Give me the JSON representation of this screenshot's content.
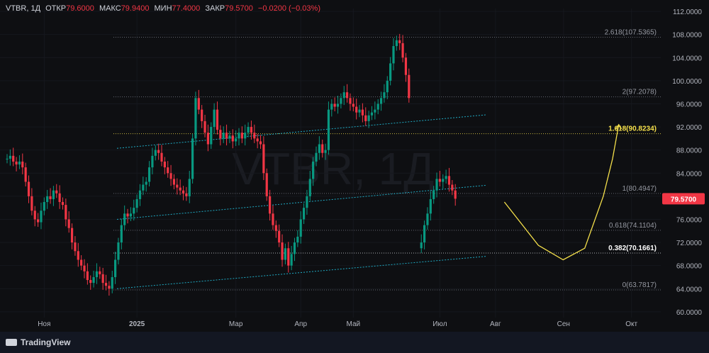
{
  "legend": {
    "symbol": "VTBR, 1Д",
    "open_label": "ОТКР",
    "open": "79.6000",
    "high_label": "МАКС",
    "high": "79.9400",
    "low_label": "МИН",
    "low": "77.4000",
    "close_label": "ЗАКР",
    "close": "79.5700",
    "change": "−0.0200 (−0.03%)"
  },
  "watermark": "VTBR, 1Д",
  "footer": {
    "brand": "TradingView"
  },
  "colors": {
    "up": "#089981",
    "down": "#f23645",
    "fib": "#787b86",
    "fib_highlight": "#f5e04b",
    "channel": "#1fa9c2",
    "projection": "#f5e04b",
    "price_tag": "#f23645"
  },
  "chart_data": {
    "type": "candlestick",
    "ylim": [
      59,
      112.5
    ],
    "y_ticks": [
      "112.0000",
      "108.0000",
      "104.0000",
      "100.0000",
      "96.0000",
      "92.0000",
      "88.0000",
      "84.0000",
      "80.0000",
      "76.0000",
      "72.0000",
      "68.0000",
      "64.0000",
      "60.0000"
    ],
    "x_ticks": [
      "Ноя",
      "2025",
      "Мар",
      "Апр",
      "Май",
      "Июл",
      "Авг",
      "Сен",
      "Окт"
    ],
    "last_price": "79.5700",
    "fib_levels": [
      {
        "label": "2.618(107.5365)",
        "value": 107.5365
      },
      {
        "label": "2(97.2078)",
        "value": 97.2078
      },
      {
        "label": "1.618(90.8234)",
        "value": 90.8234,
        "highlight": true
      },
      {
        "label": "1(80.4947)",
        "value": 80.4947
      },
      {
        "label": "0.618(74.1104)",
        "value": 74.1104
      },
      {
        "label": "0.382(70.1661)",
        "value": 70.1661,
        "highlight": true
      },
      {
        "label": "0(63.7817)",
        "value": 63.7817
      }
    ],
    "channel_lines": [
      {
        "from": [
          0,
          64.0
        ],
        "to": [
          155,
          69.6
        ]
      },
      {
        "from": [
          0,
          76.0
        ],
        "to": [
          155,
          81.9
        ]
      },
      {
        "from": [
          0,
          88.3
        ],
        "to": [
          155,
          94.1
        ]
      }
    ],
    "projection_path": [
      [
        115,
        79.0
      ],
      [
        126,
        71.5
      ],
      [
        134,
        69.0
      ],
      [
        141,
        71.0
      ],
      [
        147,
        80.0
      ],
      [
        150,
        86.5
      ],
      [
        152,
        92.4
      ]
    ],
    "closes": [
      86.5,
      87,
      86,
      85.5,
      86,
      85,
      82.5,
      80,
      77.5,
      76,
      75.5,
      77.5,
      79,
      80,
      79.5,
      81,
      80.5,
      79,
      78.5,
      76,
      74.5,
      72,
      70.5,
      69,
      68,
      67,
      65.5,
      65,
      66,
      67,
      66.5,
      65,
      64.5,
      64,
      66,
      69,
      72,
      75,
      77,
      76.5,
      77,
      78,
      79.5,
      81,
      82,
      82.5,
      85,
      87,
      88,
      87.5,
      86,
      85,
      84,
      83,
      82,
      81.5,
      81,
      80.5,
      80,
      83,
      90,
      97,
      95,
      93,
      91,
      89,
      92,
      95,
      91.5,
      90,
      91,
      90,
      90.5,
      89.5,
      90,
      91,
      90,
      91,
      92,
      91,
      90,
      89.5,
      89,
      84,
      80,
      77,
      75,
      74,
      72,
      69,
      71,
      68,
      70,
      72,
      73,
      76,
      78,
      80,
      83,
      86,
      87.5,
      89,
      87.5,
      88,
      95,
      96,
      95.5,
      96,
      97,
      98,
      97,
      96,
      95.5,
      94.5,
      95,
      94,
      93,
      94,
      94.5,
      95,
      96,
      97,
      98,
      100,
      103,
      106,
      107,
      106.5,
      104,
      101,
      97,
      95,
      93,
      92.5,
      72,
      75,
      77,
      79.5,
      81,
      83,
      82.5,
      83,
      83.5,
      82,
      81,
      79.57
    ],
    "gap": {
      "start": 130,
      "end": 134
    }
  }
}
